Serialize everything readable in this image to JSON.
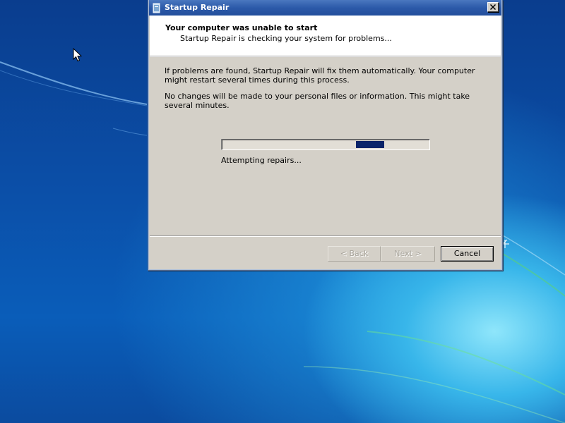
{
  "window": {
    "title": "Startup Repair",
    "close_glyph": "×"
  },
  "header": {
    "title": "Your computer was unable to start",
    "subtitle": "Startup Repair is checking your system for problems..."
  },
  "body": {
    "paragraph1": "If problems are found, Startup Repair will fix them automatically. Your computer might restart several times during this process.",
    "paragraph2": "No changes will be made to your personal files or information. This might take several minutes."
  },
  "progress": {
    "status": "Attempting repairs...",
    "indeterminate_block_start": 0.645,
    "indeterminate_block_end": 0.78,
    "fill_color": "#0a246a"
  },
  "buttons": {
    "back_label": "< Back",
    "next_label": "Next >",
    "cancel_label": "Cancel"
  },
  "colors": {
    "titlebar": "#2c5aa9",
    "dialog_face": "#d4d0c8",
    "desktop": "#0b4fa8"
  },
  "icons": {
    "title_icon": "startup-repair-icon",
    "cursor": "mouse-pointer-icon"
  }
}
